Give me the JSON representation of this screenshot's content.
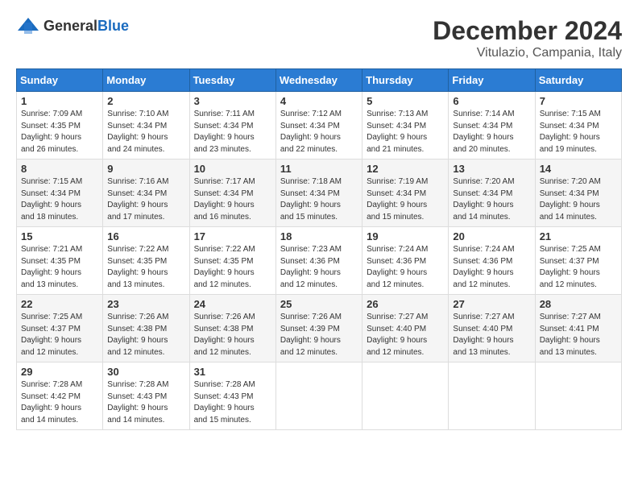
{
  "logo": {
    "general": "General",
    "blue": "Blue"
  },
  "header": {
    "month": "December 2024",
    "location": "Vitulazio, Campania, Italy"
  },
  "weekdays": [
    "Sunday",
    "Monday",
    "Tuesday",
    "Wednesday",
    "Thursday",
    "Friday",
    "Saturday"
  ],
  "weeks": [
    [
      {
        "day": "1",
        "info": "Sunrise: 7:09 AM\nSunset: 4:35 PM\nDaylight: 9 hours\nand 26 minutes."
      },
      {
        "day": "2",
        "info": "Sunrise: 7:10 AM\nSunset: 4:34 PM\nDaylight: 9 hours\nand 24 minutes."
      },
      {
        "day": "3",
        "info": "Sunrise: 7:11 AM\nSunset: 4:34 PM\nDaylight: 9 hours\nand 23 minutes."
      },
      {
        "day": "4",
        "info": "Sunrise: 7:12 AM\nSunset: 4:34 PM\nDaylight: 9 hours\nand 22 minutes."
      },
      {
        "day": "5",
        "info": "Sunrise: 7:13 AM\nSunset: 4:34 PM\nDaylight: 9 hours\nand 21 minutes."
      },
      {
        "day": "6",
        "info": "Sunrise: 7:14 AM\nSunset: 4:34 PM\nDaylight: 9 hours\nand 20 minutes."
      },
      {
        "day": "7",
        "info": "Sunrise: 7:15 AM\nSunset: 4:34 PM\nDaylight: 9 hours\nand 19 minutes."
      }
    ],
    [
      {
        "day": "8",
        "info": "Sunrise: 7:15 AM\nSunset: 4:34 PM\nDaylight: 9 hours\nand 18 minutes."
      },
      {
        "day": "9",
        "info": "Sunrise: 7:16 AM\nSunset: 4:34 PM\nDaylight: 9 hours\nand 17 minutes."
      },
      {
        "day": "10",
        "info": "Sunrise: 7:17 AM\nSunset: 4:34 PM\nDaylight: 9 hours\nand 16 minutes."
      },
      {
        "day": "11",
        "info": "Sunrise: 7:18 AM\nSunset: 4:34 PM\nDaylight: 9 hours\nand 15 minutes."
      },
      {
        "day": "12",
        "info": "Sunrise: 7:19 AM\nSunset: 4:34 PM\nDaylight: 9 hours\nand 15 minutes."
      },
      {
        "day": "13",
        "info": "Sunrise: 7:20 AM\nSunset: 4:34 PM\nDaylight: 9 hours\nand 14 minutes."
      },
      {
        "day": "14",
        "info": "Sunrise: 7:20 AM\nSunset: 4:34 PM\nDaylight: 9 hours\nand 14 minutes."
      }
    ],
    [
      {
        "day": "15",
        "info": "Sunrise: 7:21 AM\nSunset: 4:35 PM\nDaylight: 9 hours\nand 13 minutes."
      },
      {
        "day": "16",
        "info": "Sunrise: 7:22 AM\nSunset: 4:35 PM\nDaylight: 9 hours\nand 13 minutes."
      },
      {
        "day": "17",
        "info": "Sunrise: 7:22 AM\nSunset: 4:35 PM\nDaylight: 9 hours\nand 12 minutes."
      },
      {
        "day": "18",
        "info": "Sunrise: 7:23 AM\nSunset: 4:36 PM\nDaylight: 9 hours\nand 12 minutes."
      },
      {
        "day": "19",
        "info": "Sunrise: 7:24 AM\nSunset: 4:36 PM\nDaylight: 9 hours\nand 12 minutes."
      },
      {
        "day": "20",
        "info": "Sunrise: 7:24 AM\nSunset: 4:36 PM\nDaylight: 9 hours\nand 12 minutes."
      },
      {
        "day": "21",
        "info": "Sunrise: 7:25 AM\nSunset: 4:37 PM\nDaylight: 9 hours\nand 12 minutes."
      }
    ],
    [
      {
        "day": "22",
        "info": "Sunrise: 7:25 AM\nSunset: 4:37 PM\nDaylight: 9 hours\nand 12 minutes."
      },
      {
        "day": "23",
        "info": "Sunrise: 7:26 AM\nSunset: 4:38 PM\nDaylight: 9 hours\nand 12 minutes."
      },
      {
        "day": "24",
        "info": "Sunrise: 7:26 AM\nSunset: 4:38 PM\nDaylight: 9 hours\nand 12 minutes."
      },
      {
        "day": "25",
        "info": "Sunrise: 7:26 AM\nSunset: 4:39 PM\nDaylight: 9 hours\nand 12 minutes."
      },
      {
        "day": "26",
        "info": "Sunrise: 7:27 AM\nSunset: 4:40 PM\nDaylight: 9 hours\nand 12 minutes."
      },
      {
        "day": "27",
        "info": "Sunrise: 7:27 AM\nSunset: 4:40 PM\nDaylight: 9 hours\nand 13 minutes."
      },
      {
        "day": "28",
        "info": "Sunrise: 7:27 AM\nSunset: 4:41 PM\nDaylight: 9 hours\nand 13 minutes."
      }
    ],
    [
      {
        "day": "29",
        "info": "Sunrise: 7:28 AM\nSunset: 4:42 PM\nDaylight: 9 hours\nand 14 minutes."
      },
      {
        "day": "30",
        "info": "Sunrise: 7:28 AM\nSunset: 4:43 PM\nDaylight: 9 hours\nand 14 minutes."
      },
      {
        "day": "31",
        "info": "Sunrise: 7:28 AM\nSunset: 4:43 PM\nDaylight: 9 hours\nand 15 minutes."
      },
      null,
      null,
      null,
      null
    ]
  ]
}
